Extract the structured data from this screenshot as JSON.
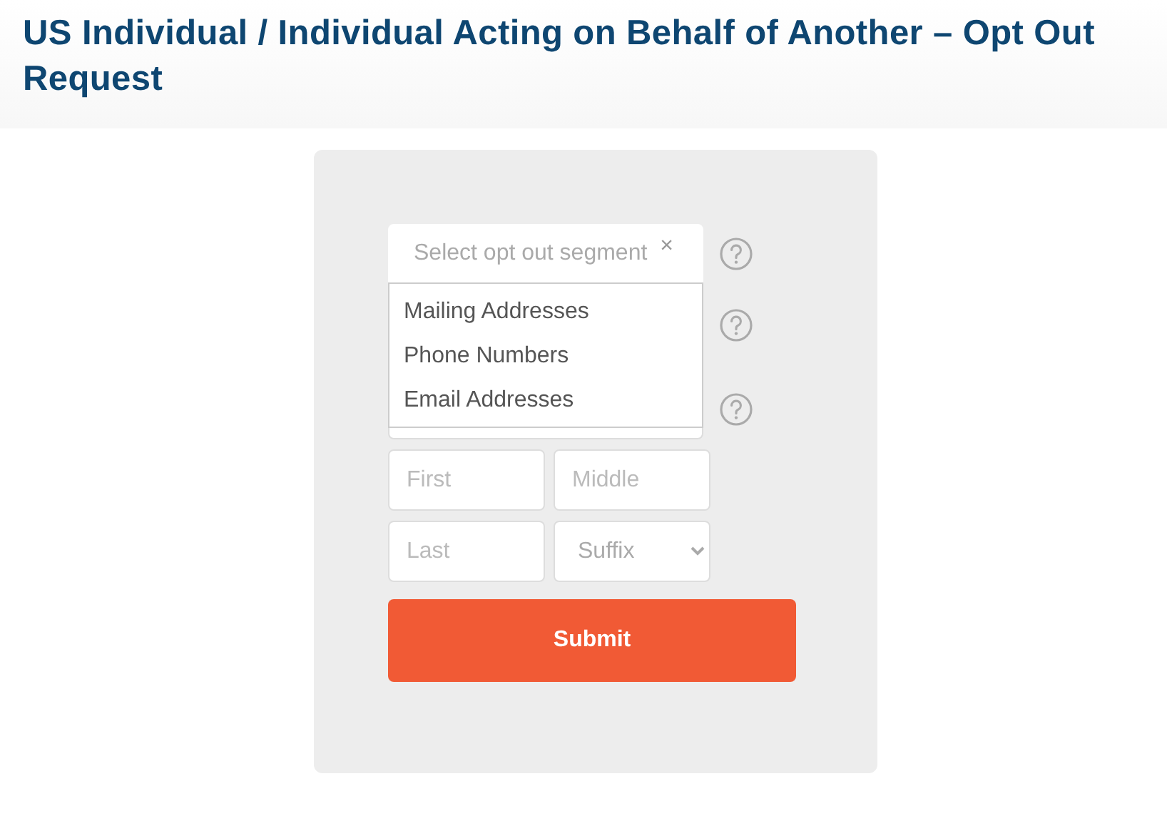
{
  "page_title": "US Individual / Individual Acting on Behalf of Another – Opt Out Request",
  "segment_select": {
    "placeholder": "Select opt out segment",
    "clear": "×",
    "expanded": true
  },
  "segment_options": [
    "Mailing Addresses",
    "Phone Numbers",
    "Email Addresses"
  ],
  "name_fields": [
    {
      "placeholder": "First"
    },
    {
      "placeholder": "Middle"
    },
    {
      "placeholder": "Last"
    }
  ],
  "suffix_select": {
    "placeholder": "Suffix"
  },
  "submit_button": "Submit"
}
